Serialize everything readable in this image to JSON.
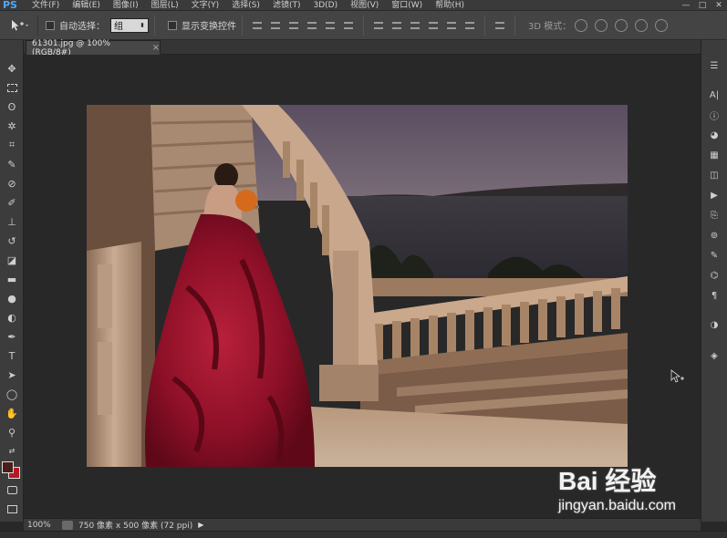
{
  "app": {
    "logo": "PS"
  },
  "menu": [
    "文件(F)",
    "编辑(E)",
    "图像(I)",
    "图层(L)",
    "文字(Y)",
    "选择(S)",
    "滤镜(T)",
    "3D(D)",
    "视图(V)",
    "窗口(W)",
    "帮助(H)"
  ],
  "window_controls": [
    "—",
    "□",
    "✕"
  ],
  "options_bar": {
    "auto_select_label": "自动选择：",
    "auto_select_value": "组",
    "show_transform_label": "显示变换控件",
    "mode_3d_label": "3D 模式："
  },
  "document": {
    "tab_title": "61301.jpg @ 100%(RGB/8#)",
    "close_glyph": "×"
  },
  "status": {
    "zoom": "100%",
    "size_info": "750 像素 x 500 像素 (72 ppi)"
  },
  "colors": {
    "foreground": "#4a1e18",
    "background": "#b31824",
    "ui_dark": "#282828",
    "panel": "#3c3c3c"
  },
  "watermark": {
    "brand": "Bai 经验",
    "url": "jingyan.baidu.com"
  }
}
